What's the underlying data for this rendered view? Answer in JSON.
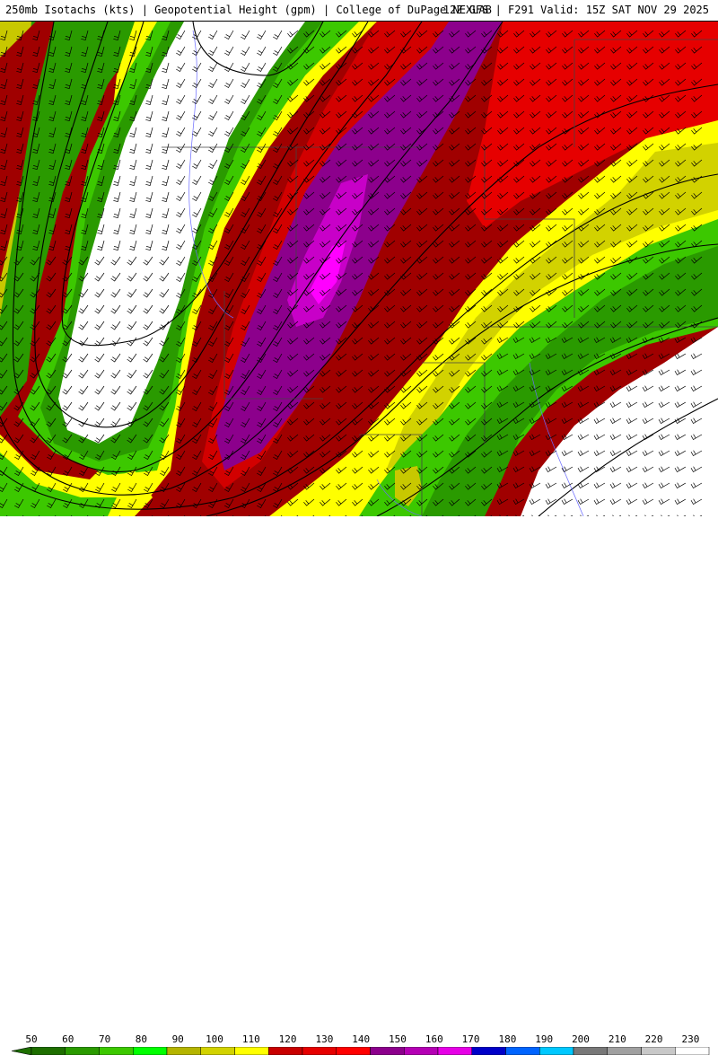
{
  "header": {
    "left": "250mb Isotachs (kts) | Geopotential Height (gpm) | College of DuPage NEXLAB",
    "right": "12Z GFS | F291 Valid: 15Z SAT NOV 29 2025"
  },
  "colorbar": {
    "labels": [
      "50",
      "60",
      "70",
      "80",
      "90",
      "100",
      "110",
      "120",
      "130",
      "140",
      "150",
      "160",
      "170",
      "180",
      "190",
      "200",
      "210",
      "220",
      "230"
    ],
    "colors": [
      "#1e6e00",
      "#2a9a00",
      "#3cc800",
      "#00ff00",
      "#b4b400",
      "#d2d200",
      "#ffff00",
      "#c80000",
      "#e60000",
      "#ff0000",
      "#8c008c",
      "#b400b4",
      "#e600e6",
      "#0000c8",
      "#0064ff",
      "#00c8ff",
      "#787878",
      "#a0a0a0",
      "#c8c8c8",
      "#ffffff"
    ]
  },
  "map": {
    "colors": {
      "calm": "#ffffff",
      "green_dark": "#1e6e00",
      "green": "#2a9a00",
      "green_light": "#3cc800",
      "yellow_dark": "#c8c800",
      "yellow": "#ffff00",
      "red_dark": "#a00000",
      "red": "#d20000",
      "red_bright": "#ff0000",
      "purple": "#8c008c",
      "magenta": "#e600e6",
      "contour": "#000000",
      "border": "#555555",
      "river": "#6a6aff"
    }
  }
}
